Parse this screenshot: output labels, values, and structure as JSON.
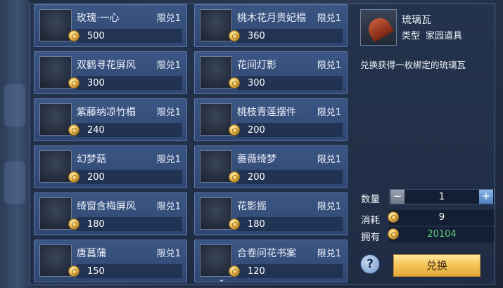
{
  "items": [
    {
      "name": "玫瑰·一心",
      "limit": "限兑1",
      "price": "500",
      "icon": "rose-garland-icon"
    },
    {
      "name": "桃木花月贵妃榻",
      "limit": "限兑1",
      "price": "360",
      "icon": "couch-icon"
    },
    {
      "name": "双鹤寻花屏风",
      "limit": "限兑1",
      "price": "300",
      "icon": "screen-icon"
    },
    {
      "name": "花间灯影",
      "limit": "限兑1",
      "price": "300",
      "icon": "pavilion-icon"
    },
    {
      "name": "紫藤纳凉竹榻",
      "limit": "限兑1",
      "price": "240",
      "icon": "bamboo-bed-icon"
    },
    {
      "name": "桃枝青莲摆件",
      "limit": "限兑1",
      "price": "200",
      "icon": "lotus-ornament-icon"
    },
    {
      "name": "幻梦菇",
      "limit": "限兑1",
      "price": "200",
      "icon": "mushroom-icon"
    },
    {
      "name": "蔷薇绮梦",
      "limit": "限兑1",
      "price": "200",
      "icon": "rose-plant-icon"
    },
    {
      "name": "绮窗含梅屏风",
      "limit": "限兑1",
      "price": "180",
      "icon": "plum-screen-icon"
    },
    {
      "name": "花影摇",
      "limit": "限兑1",
      "price": "180",
      "icon": "flower-swing-icon"
    },
    {
      "name": "唐菖蒲",
      "limit": "限兑1",
      "price": "150",
      "icon": "gladiolus-icon"
    },
    {
      "name": "合卷问花书案",
      "limit": "限兑1",
      "price": "120",
      "icon": "desk-icon"
    }
  ],
  "detail": {
    "title": "琉璃瓦",
    "type_label": "类型",
    "type_value": "家园道具",
    "description": "兑换获得一枚绑定的琉璃瓦",
    "icon": "glazed-tile-icon"
  },
  "purchase": {
    "qty_label": "数量",
    "qty_value": "1",
    "minus": "−",
    "plus": "+",
    "cost_label": "消耗",
    "cost_value": "9",
    "own_label": "拥有",
    "own_value": "20104",
    "help": "?",
    "exchange_label": "兑换"
  },
  "scroll_indicator": "⌄",
  "colors": {
    "panel": "#24334d",
    "card": "#3c5684",
    "owned": "#5fd17a",
    "button": "#f3c356"
  }
}
